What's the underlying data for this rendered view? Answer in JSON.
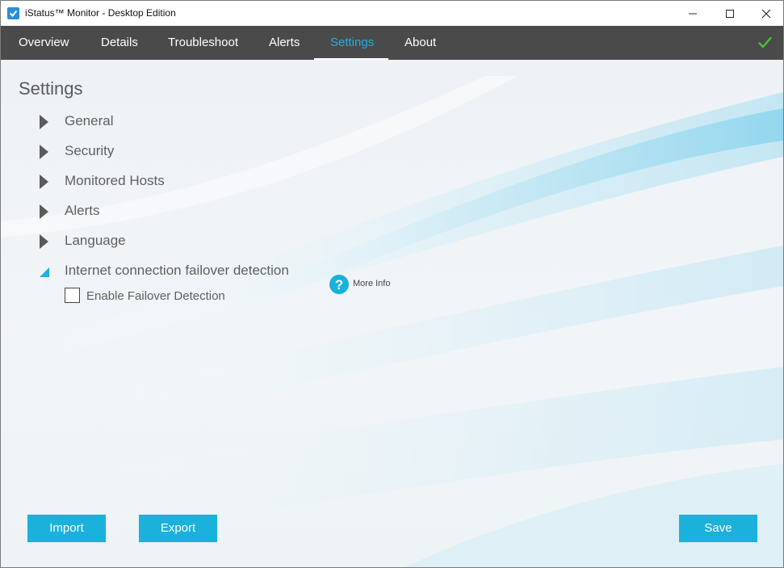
{
  "window": {
    "title": "iStatus™ Monitor - Desktop Edition",
    "app_icon": "app-check-icon",
    "controls": [
      "minimize-icon",
      "maximize-icon",
      "close-icon"
    ]
  },
  "nav": {
    "tabs": [
      {
        "label": "Overview"
      },
      {
        "label": "Details"
      },
      {
        "label": "Troubleshoot"
      },
      {
        "label": "Alerts"
      },
      {
        "label": "Settings"
      },
      {
        "label": "About"
      }
    ],
    "active_tab": "Settings",
    "status_icon": "green-checkmark-icon"
  },
  "page": {
    "title": "Settings",
    "sections": [
      {
        "label": "General",
        "expanded": false
      },
      {
        "label": "Security",
        "expanded": false
      },
      {
        "label": "Monitored Hosts",
        "expanded": false
      },
      {
        "label": "Alerts",
        "expanded": false
      },
      {
        "label": "Language",
        "expanded": false
      },
      {
        "label": "Internet connection failover detection",
        "expanded": true
      }
    ],
    "failover": {
      "checkbox_label": "Enable Failover Detection",
      "checked": false,
      "more_info_label": "More Info",
      "more_info_icon": "question-circle-icon"
    }
  },
  "buttons": {
    "import_label": "Import",
    "export_label": "Export",
    "save_label": "Save"
  },
  "colors": {
    "accent": "#1ab1db",
    "nav_bg": "#4a4a4a",
    "status_green": "#4cc13a"
  }
}
